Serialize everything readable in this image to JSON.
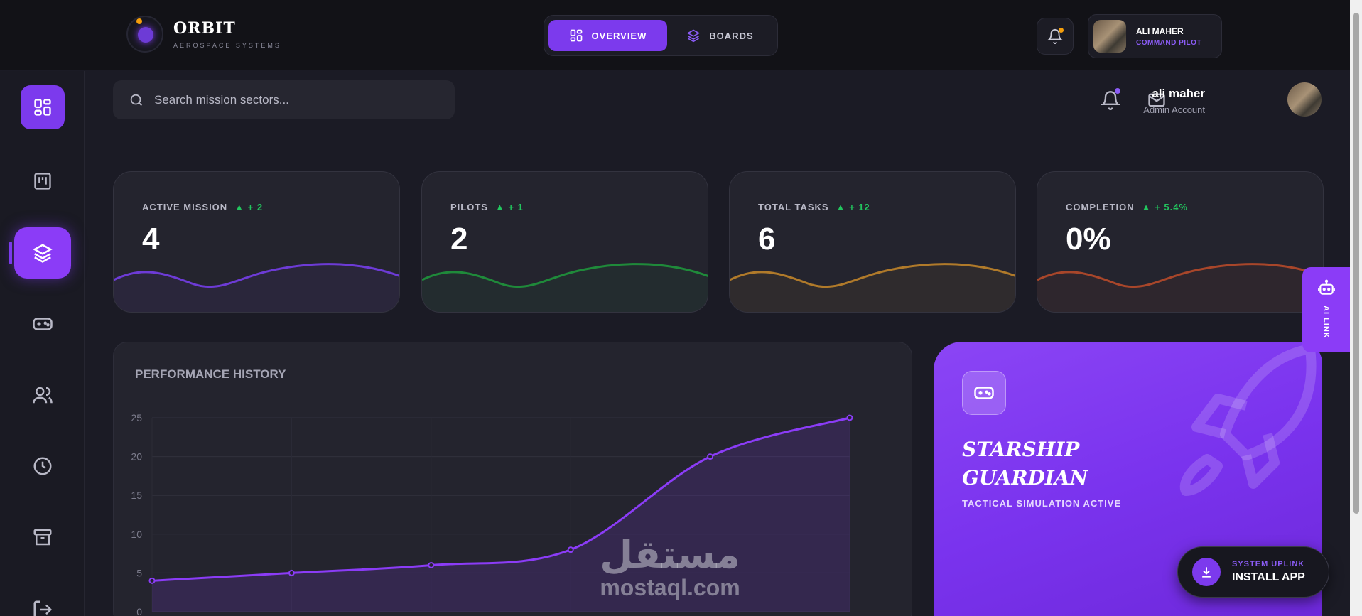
{
  "brand": {
    "title": "ORBIT",
    "subtitle": "AEROSPACE SYSTEMS"
  },
  "topnav": {
    "tabs": [
      {
        "label": "OVERVIEW",
        "icon": "dashboard-icon"
      },
      {
        "label": "BOARDS",
        "icon": "layers-icon"
      }
    ]
  },
  "top_user": {
    "name": "ALI MAHER",
    "role": "COMMAND PILOT"
  },
  "search": {
    "placeholder": "Search mission sectors..."
  },
  "header_user": {
    "name": "ali maher",
    "role": "Admin Account"
  },
  "sidebar": {
    "items": [
      "dashboard-icon",
      "kanban-icon",
      "layers-icon",
      "gamepad-icon",
      "users-icon",
      "clock-icon",
      "archive-icon",
      "logout-icon"
    ]
  },
  "stats": [
    {
      "label": "ACTIVE MISSION",
      "delta": "▲ + 2",
      "value": "4",
      "color": "#6d3bd6"
    },
    {
      "label": "PILOTS",
      "delta": "▲ + 1",
      "value": "2",
      "color": "#1f8a3a"
    },
    {
      "label": "TOTAL TASKS",
      "delta": "▲ + 12",
      "value": "6",
      "color": "#b07a2a"
    },
    {
      "label": "COMPLETION",
      "delta": "▲ + 5.4%",
      "value": "0%",
      "color": "#a8462a"
    }
  ],
  "performance": {
    "title": "PERFORMANCE HISTORY"
  },
  "chart_data": {
    "type": "line",
    "title": "PERFORMANCE HISTORY",
    "x": [
      1,
      2,
      3,
      4,
      5,
      6
    ],
    "values": [
      4,
      5,
      6,
      8,
      20,
      25
    ],
    "ylim": [
      0,
      25
    ],
    "yticks": [
      "0",
      "5",
      "10",
      "15",
      "20",
      "25"
    ],
    "grid": true,
    "color": "#8b3cf7"
  },
  "starship": {
    "title": "STARSHIP GUARDIAN",
    "subtitle": "TACTICAL SIMULATION ACTIVE"
  },
  "install": {
    "kicker": "SYSTEM UPLINK",
    "label": "INSTALL APP"
  },
  "ailink": {
    "label": "AI LINK"
  },
  "watermark": {
    "arabic": "مستقل",
    "latin": "mostaql.com"
  }
}
